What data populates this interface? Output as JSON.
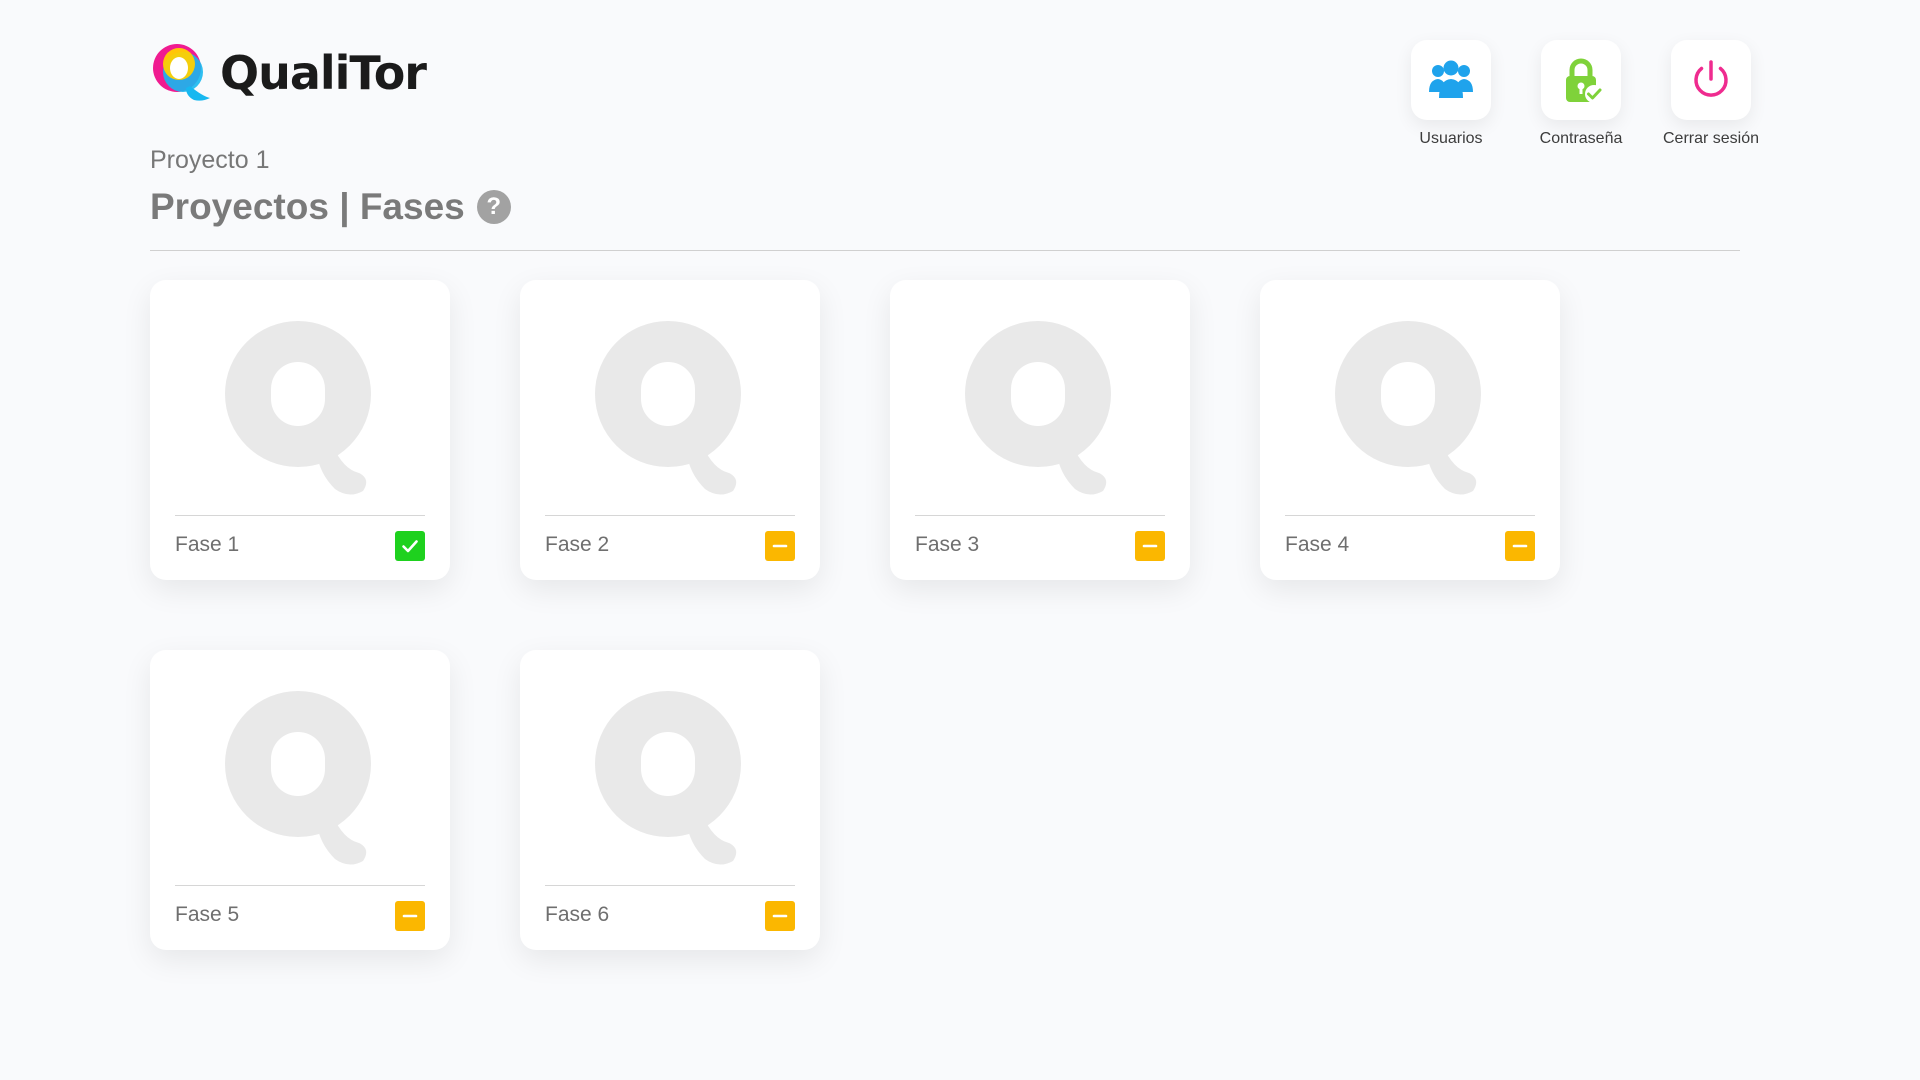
{
  "brand": {
    "name": "QualiTor",
    "colors": {
      "magenta": "#f01b90",
      "yellow": "#ffd000",
      "cyan": "#17b8f0",
      "text": "#1b1b1b"
    }
  },
  "actions": [
    {
      "label": "Usuarios",
      "icon": "users-icon",
      "color": "#1fa3ec"
    },
    {
      "label": "Contraseña",
      "icon": "lock-check-icon",
      "color": "#7fd23a"
    },
    {
      "label": "Cerrar sesión",
      "icon": "power-icon",
      "color": "#ef2b8f"
    }
  ],
  "header": {
    "project": "Proyecto 1",
    "title": "Proyectos | Fases",
    "help_symbol": "?"
  },
  "phases": [
    {
      "label": "Fase 1",
      "status": "done",
      "status_color": "#1ed11e"
    },
    {
      "label": "Fase 2",
      "status": "pending",
      "status_color": "#fbb700"
    },
    {
      "label": "Fase 3",
      "status": "pending",
      "status_color": "#fbb700"
    },
    {
      "label": "Fase 4",
      "status": "pending",
      "status_color": "#fbb700"
    },
    {
      "label": "Fase 5",
      "status": "pending",
      "status_color": "#fbb700"
    },
    {
      "label": "Fase 6",
      "status": "pending",
      "status_color": "#fbb700"
    }
  ]
}
